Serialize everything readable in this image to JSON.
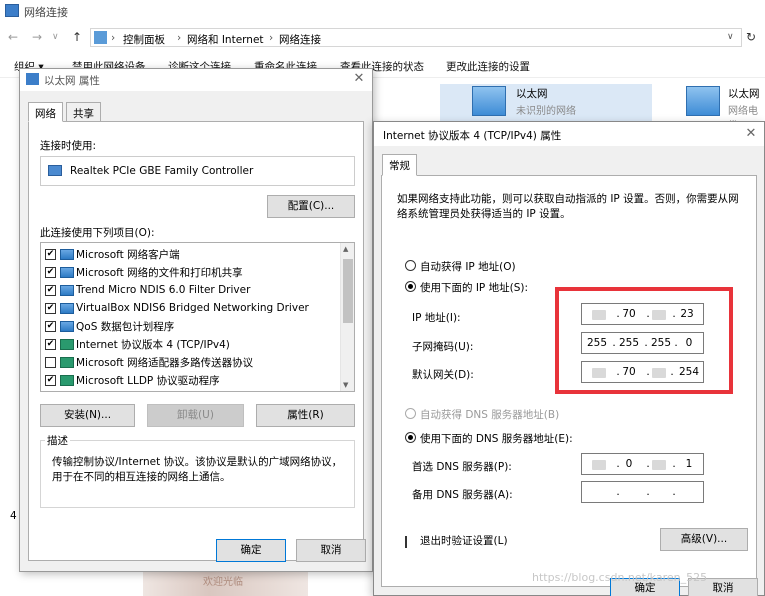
{
  "explorer": {
    "title": "网络连接",
    "breadcrumb": [
      "控制面板",
      "网络和 Internet",
      "网络连接"
    ],
    "commands": [
      "组织 ▾",
      "禁用此网络设备",
      "诊断这个连接",
      "重命名此连接",
      "查看此连接的状态",
      "更改此连接的设置"
    ],
    "connection1": {
      "name": "以太网",
      "status": "未识别的网络"
    },
    "connection2": {
      "name": "以太网",
      "status": "网络电缆"
    },
    "side_number": "4"
  },
  "eth_dialog": {
    "title": "以太网 属性",
    "tabs": [
      "网络",
      "共享"
    ],
    "connect_using_label": "连接时使用:",
    "adapter": "Realtek PCIe GBE Family Controller",
    "configure_button": "配置(C)...",
    "items_label": "此连接使用下列项目(O):",
    "items": [
      {
        "label": "Microsoft 网络客户端",
        "checked": true
      },
      {
        "label": "Microsoft 网络的文件和打印机共享",
        "checked": true
      },
      {
        "label": "Trend Micro NDIS 6.0 Filter Driver",
        "checked": true
      },
      {
        "label": "VirtualBox NDIS6 Bridged Networking Driver",
        "checked": true
      },
      {
        "label": "QoS 数据包计划程序",
        "checked": true
      },
      {
        "label": "Internet 协议版本 4 (TCP/IPv4)",
        "checked": true
      },
      {
        "label": "Microsoft 网络适配器多路传送器协议",
        "checked": false
      },
      {
        "label": "Microsoft LLDP 协议驱动程序",
        "checked": true
      }
    ],
    "install_button": "安装(N)...",
    "uninstall_button": "卸载(U)",
    "properties_button": "属性(R)",
    "description_legend": "描述",
    "description": "传输控制协议/Internet 协议。该协议是默认的广域网络协议，用于在不同的相互连接的网络上通信。",
    "ok_button": "确定",
    "cancel_button": "取消"
  },
  "ipv4_dialog": {
    "title": "Internet 协议版本 4 (TCP/IPv4) 属性",
    "tab": "常规",
    "intro": "如果网络支持此功能，则可以获取自动指派的 IP 设置。否则，你需要从网络系统管理员处获得适当的 IP 设置。",
    "auto_ip_label": "自动获得 IP 地址(O)",
    "manual_ip_label": "使用下面的 IP 地址(S):",
    "ip_label": "IP 地址(I):",
    "ip_octets": [
      "",
      "70",
      "",
      "23"
    ],
    "mask_label": "子网掩码(U):",
    "mask_octets": [
      "255",
      "255",
      "255",
      "0"
    ],
    "gateway_label": "默认网关(D):",
    "gateway_octets": [
      "",
      "70",
      "",
      "254"
    ],
    "auto_dns_label": "自动获得 DNS 服务器地址(B)",
    "manual_dns_label": "使用下面的 DNS 服务器地址(E):",
    "dns1_label": "首选 DNS 服务器(P):",
    "dns1_octets": [
      "",
      "0",
      "",
      "1"
    ],
    "dns2_label": "备用 DNS 服务器(A):",
    "dns2_octets": [
      "",
      "",
      "",
      ""
    ],
    "validate_label": "退出时验证设置(L)",
    "advanced_button": "高级(V)...",
    "ok_button": "确定",
    "cancel_button": "取消"
  },
  "watermark": "https://blog.csdn.net/karen_525",
  "bg_text": "欢迎光临",
  "colors": {
    "highlight": "#e8333a",
    "accent": "#0078d7"
  }
}
